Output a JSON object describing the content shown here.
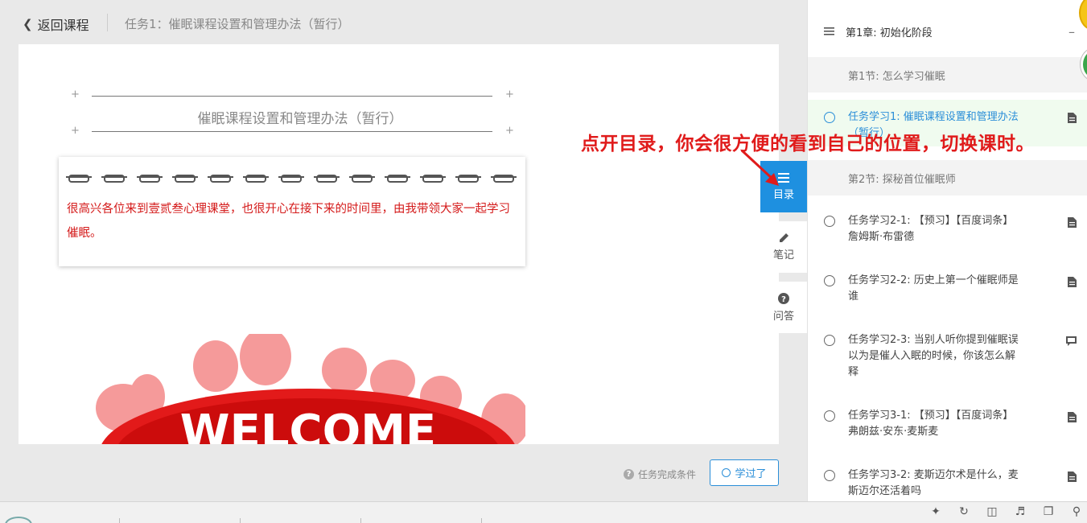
{
  "header": {
    "back_label": "返回课程",
    "task_title": "任务1：催眠课程设置和管理办法（暂行）"
  },
  "document": {
    "title": "催眠课程设置和管理办法（暂行）",
    "intro_text": "很高兴各位来到壹贰叁心理课堂，也很开心在接下来的时间里，由我带领大家一起学习催眠。",
    "banner_text": "WELCOME"
  },
  "footer": {
    "condition_label": "任务完成条件",
    "learned_button": "学过了"
  },
  "tools": [
    {
      "label": "目录",
      "icon": "list-icon",
      "active": true
    },
    {
      "label": "笔记",
      "icon": "pencil-icon",
      "active": false
    },
    {
      "label": "问答",
      "icon": "question-icon",
      "active": false
    }
  ],
  "catalog": {
    "chapter": "第1章: 初始化阶段",
    "sections": [
      {
        "title": "第1节: 怎么学习催眠",
        "items": [
          {
            "label": "任务学习1: 催眠课程设置和管理办法（暂行）",
            "type": "document-icon",
            "active": true
          }
        ]
      },
      {
        "title": "第2节: 探秘首位催眠师",
        "items": [
          {
            "label": "任务学习2-1: 【预习】【百度词条】詹姆斯·布雷德",
            "type": "document-icon"
          },
          {
            "label": "任务学习2-2: 历史上第一个催眠师是谁",
            "type": "document-icon"
          },
          {
            "label": "任务学习2-3: 当别人听你提到催眠误以为是催人入眠的时候，你该怎么解释",
            "type": "discussion-icon"
          },
          {
            "label": "任务学习3-1: 【预习】【百度词条】弗朗兹·安东·麦斯麦",
            "type": "document-icon"
          },
          {
            "label": "任务学习3-2: 麦斯迈尔术是什么，麦斯迈尔还活着吗",
            "type": "document-icon"
          }
        ]
      }
    ]
  },
  "annotation": "点开目录，你会很方便的看到自己的位置，切换课时。",
  "colors": {
    "accent": "#1e90e0",
    "annotation": "#e01b1b",
    "intro_text": "#d41a1a",
    "active_item_bg": "#f0fbef"
  }
}
